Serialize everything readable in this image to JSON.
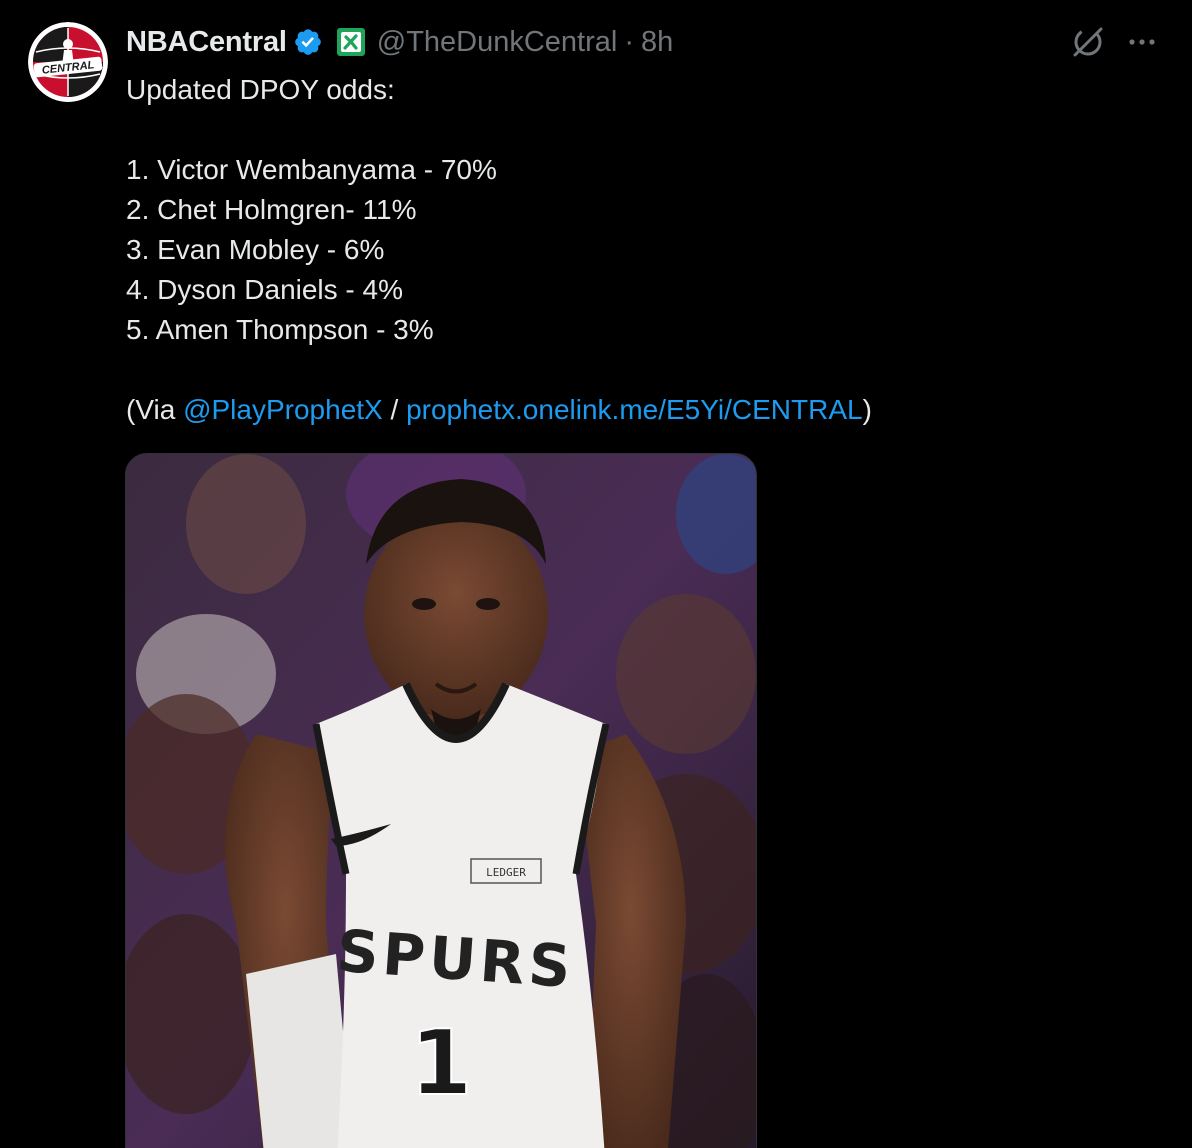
{
  "author": {
    "display_name": "NBACentral",
    "handle": "@TheDunkCentral",
    "separator": "·",
    "time": "8h",
    "avatar_text": "CENTRAL"
  },
  "tweet": {
    "intro": "Updated DPOY odds:",
    "list": [
      "1. Victor Wembanyama - 70%",
      "2. Chet Holmgren- 11%",
      "3. Evan Mobley - 6%",
      "4. Dyson Daniels - 4%",
      "5. Amen Thompson - 3%"
    ],
    "via_prefix": "(Via ",
    "via_mention": "@PlayProphetX",
    "via_sep": " / ",
    "via_link": "prophetx.onelink.me/E5Yi/CENTRAL",
    "via_suffix": ")"
  },
  "media": {
    "jersey_sponsor": "LEDGER",
    "jersey_team": "SPURS",
    "jersey_number": "1"
  },
  "icons": {
    "verified": "verified-badge-icon",
    "affiliate": "affiliate-badge-icon",
    "grok": "grok-icon",
    "more": "more-icon"
  },
  "colors": {
    "background": "#000000",
    "text": "#e7e9ea",
    "muted": "#71767b",
    "link": "#1d9bf0",
    "verified": "#1d9bf0",
    "affiliate": "#1ea55a"
  }
}
